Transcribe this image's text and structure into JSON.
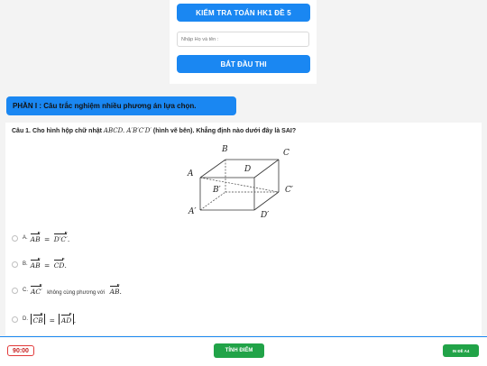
{
  "header": {
    "title": "KIỂM TRA TOÁN HK1 ĐỀ 5",
    "name_placeholder": "Nhập Họ và tên :",
    "start_label": "BẮT ĐẦU THI"
  },
  "section": {
    "title": "PHẦN I : Câu trắc nghiệm nhiều phương án lựa chọn."
  },
  "question": {
    "prefix": "Câu 1. Cho hình hộp chữ nhật",
    "math": "ABCD. A′B′C′D′",
    "suffix": "(hình vẽ bên). Khẳng định nào dưới đây là SAI?",
    "figure_labels": {
      "A": "A",
      "B": "B",
      "C": "C",
      "D": "D",
      "A1": "A′",
      "B1": "B′",
      "C1": "C′",
      "D1": "D′"
    },
    "options": [
      {
        "letter": "A.",
        "v1": "AB",
        "rel": "=",
        "v2": "D′C′",
        "end": "."
      },
      {
        "letter": "B.",
        "v1": "AB",
        "rel": "=",
        "v2": "CD",
        "end": "."
      },
      {
        "letter": "C.",
        "v1": "AC′",
        "text": "không cùng phương với",
        "v2": "AB",
        "end": "."
      },
      {
        "letter": "D.",
        "v1": "CB",
        "rel": "=",
        "v2": "AD",
        "end": "."
      }
    ]
  },
  "footer": {
    "timer": "90:00",
    "submit_label": "TÍNH ĐIỂM",
    "print_label": "IN ĐỀ A4"
  },
  "colors": {
    "primary": "#1a87f2",
    "success": "#21a348",
    "danger": "#e23a3a"
  }
}
